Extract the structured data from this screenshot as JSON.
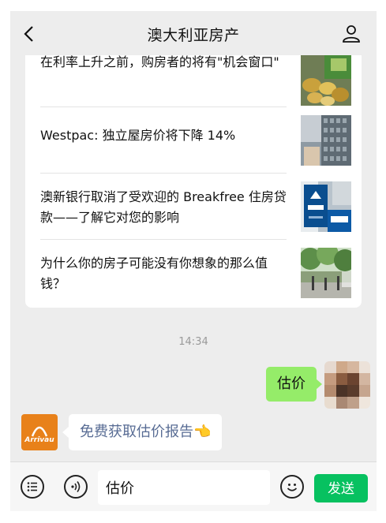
{
  "header": {
    "title": "澳大利亚房产",
    "back_icon": "chevron-left-icon",
    "profile_icon": "person-icon"
  },
  "articles": [
    {
      "title": "在利率上升之前，购房者的将有\"机会窗口\"",
      "thumb": "coins-cash-image"
    },
    {
      "title": "Westpac: 独立屋房价将下降 14%",
      "thumb": "city-building-image"
    },
    {
      "title": "澳新银行取消了受欢迎的 Breakfree 住房贷款——了解它对您的影响",
      "thumb": "anz-bank-sign-image"
    },
    {
      "title": "为什么你的房子可能没有你想象的那么值钱？",
      "thumb": "street-trees-image"
    }
  ],
  "timestamp": "14:34",
  "outgoing_message": "估价",
  "incoming": {
    "brand": "Arrivau",
    "message": "免费获取估价报告👈"
  },
  "input_bar": {
    "list_icon": "menu-list-icon",
    "voice_icon": "voice-icon",
    "input_value": "估价",
    "emoji_icon": "smiley-icon",
    "send_label": "发送"
  },
  "colors": {
    "background": "#ededed",
    "outgoing_bubble": "#95ec69",
    "send_button": "#07c160",
    "link_text": "#586c94",
    "brand_orange": "#e8811a"
  }
}
